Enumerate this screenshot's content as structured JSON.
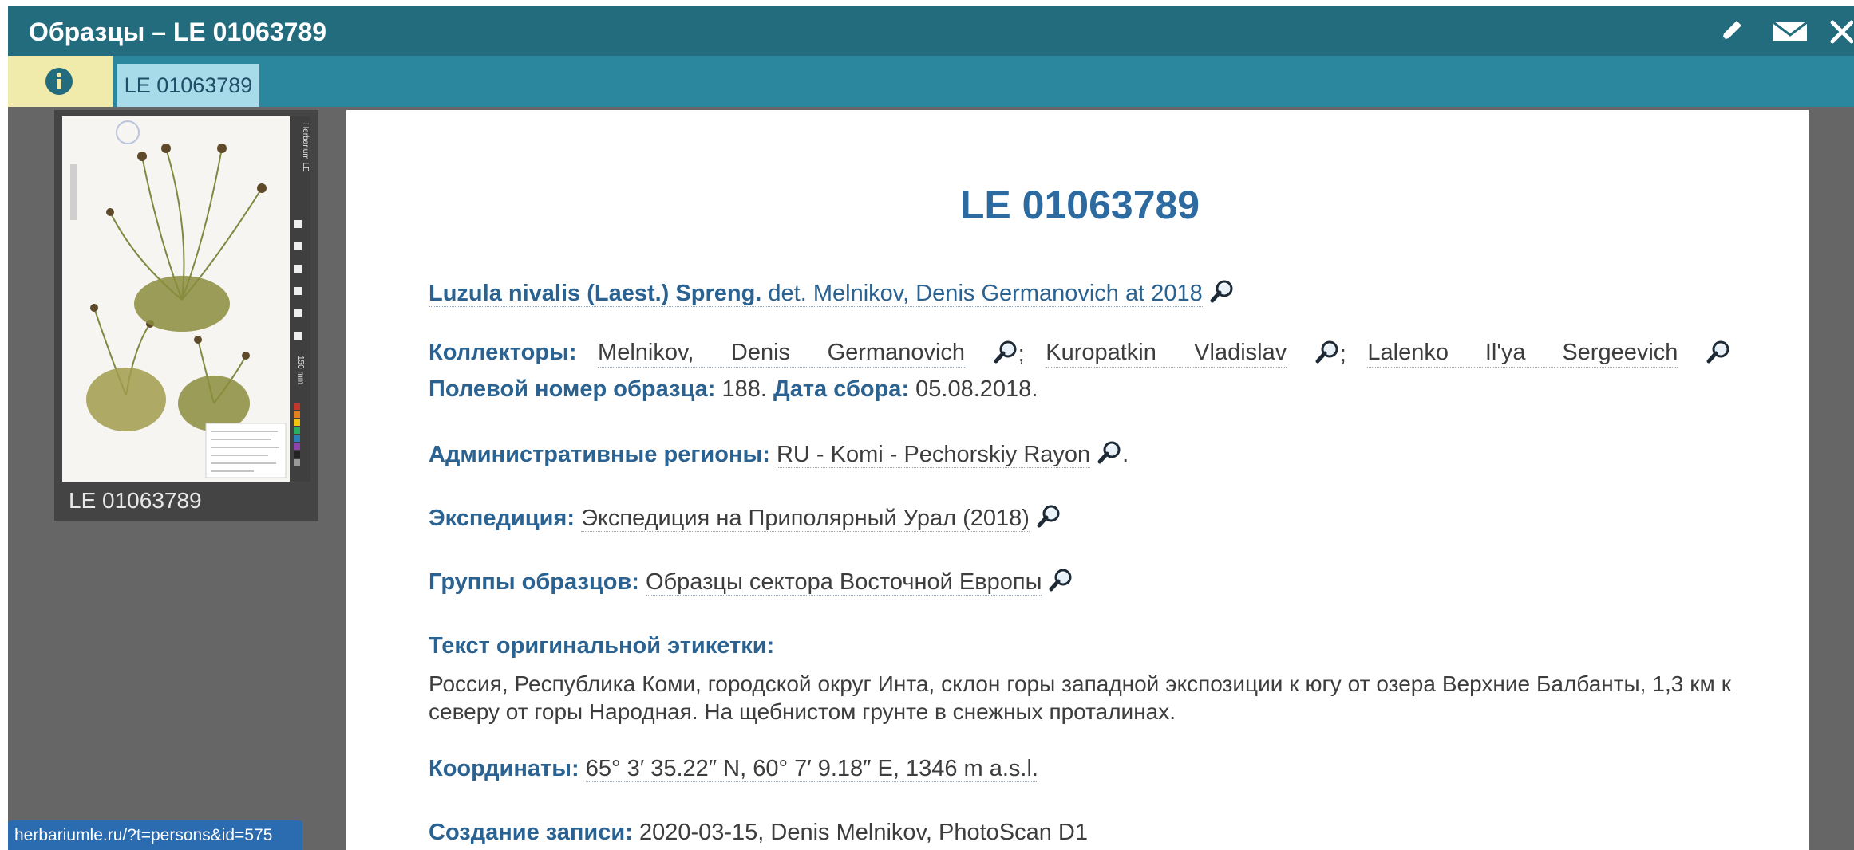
{
  "window": {
    "title": "Образцы – LE 01063789",
    "icons": [
      "pencil-icon",
      "envelope-icon",
      "close-icon"
    ]
  },
  "tabs": {
    "info_icon": "info-icon",
    "active_label": "LE 01063789"
  },
  "thumbnail": {
    "caption": "LE 01063789",
    "sheet_side_text": "Herbarium LE",
    "scale_text": "150 mm"
  },
  "record": {
    "title": "LE 01063789",
    "taxon": {
      "name": "Luzula nivalis (Laest.) Spreng.",
      "det": "det. Melnikov, Denis Germanovich at 2018"
    },
    "collectors": {
      "label": "Коллекторы:",
      "items": [
        [
          "Melnikov,",
          "Denis",
          "Germanovich"
        ],
        [
          "Kuropatkin",
          "Vladislav"
        ],
        [
          "Lalenko",
          "Il'ya",
          "Sergeevich"
        ]
      ],
      "separator": ";"
    },
    "field_number": {
      "label": "Полевой номер образца:",
      "value": "188.",
      "date_label": "Дата сбора:",
      "date_value": "05.08.2018."
    },
    "admin_regions": {
      "label": "Административные регионы:",
      "value": "RU - Komi - Pechorskiy Rayon",
      "suffix": "."
    },
    "expedition": {
      "label": "Экспедиция:",
      "value": "Экспедиция на Приполярный Урал (2018)"
    },
    "groups": {
      "label": "Группы образцов:",
      "value": "Образцы сектора Восточной Европы"
    },
    "original_label": {
      "label": "Текст оригинальной этикетки:",
      "text": "Россия, Республика Коми, городской округ Инта, склон горы западной экспозиции к югу от озера Верхние Балбанты, 1,3 км к северу от горы Народная. На щебнистом грунте в снежных проталинах."
    },
    "coordinates": {
      "label": "Координаты:",
      "value": "65° 3′ 35.22″ N, 60° 7′ 9.18″ E, 1346 m a.s.l."
    },
    "created": {
      "label": "Создание записи:",
      "value": "2020-03-15, Denis Melnikov, PhotoScan D1"
    },
    "search_icon": "magnifier-icon"
  },
  "status": {
    "url": "herbariumle.ru/?t=persons&id=575"
  },
  "colors": {
    "titlebar": "#226c7e",
    "tabbar": "#2b879e",
    "info_tab": "#f0ebaa",
    "active_tab": "#a8dbea",
    "label_blue": "#2a6291",
    "title_blue": "#2d6aa0",
    "status_blue": "#2b6bb0",
    "background": "#666666"
  }
}
